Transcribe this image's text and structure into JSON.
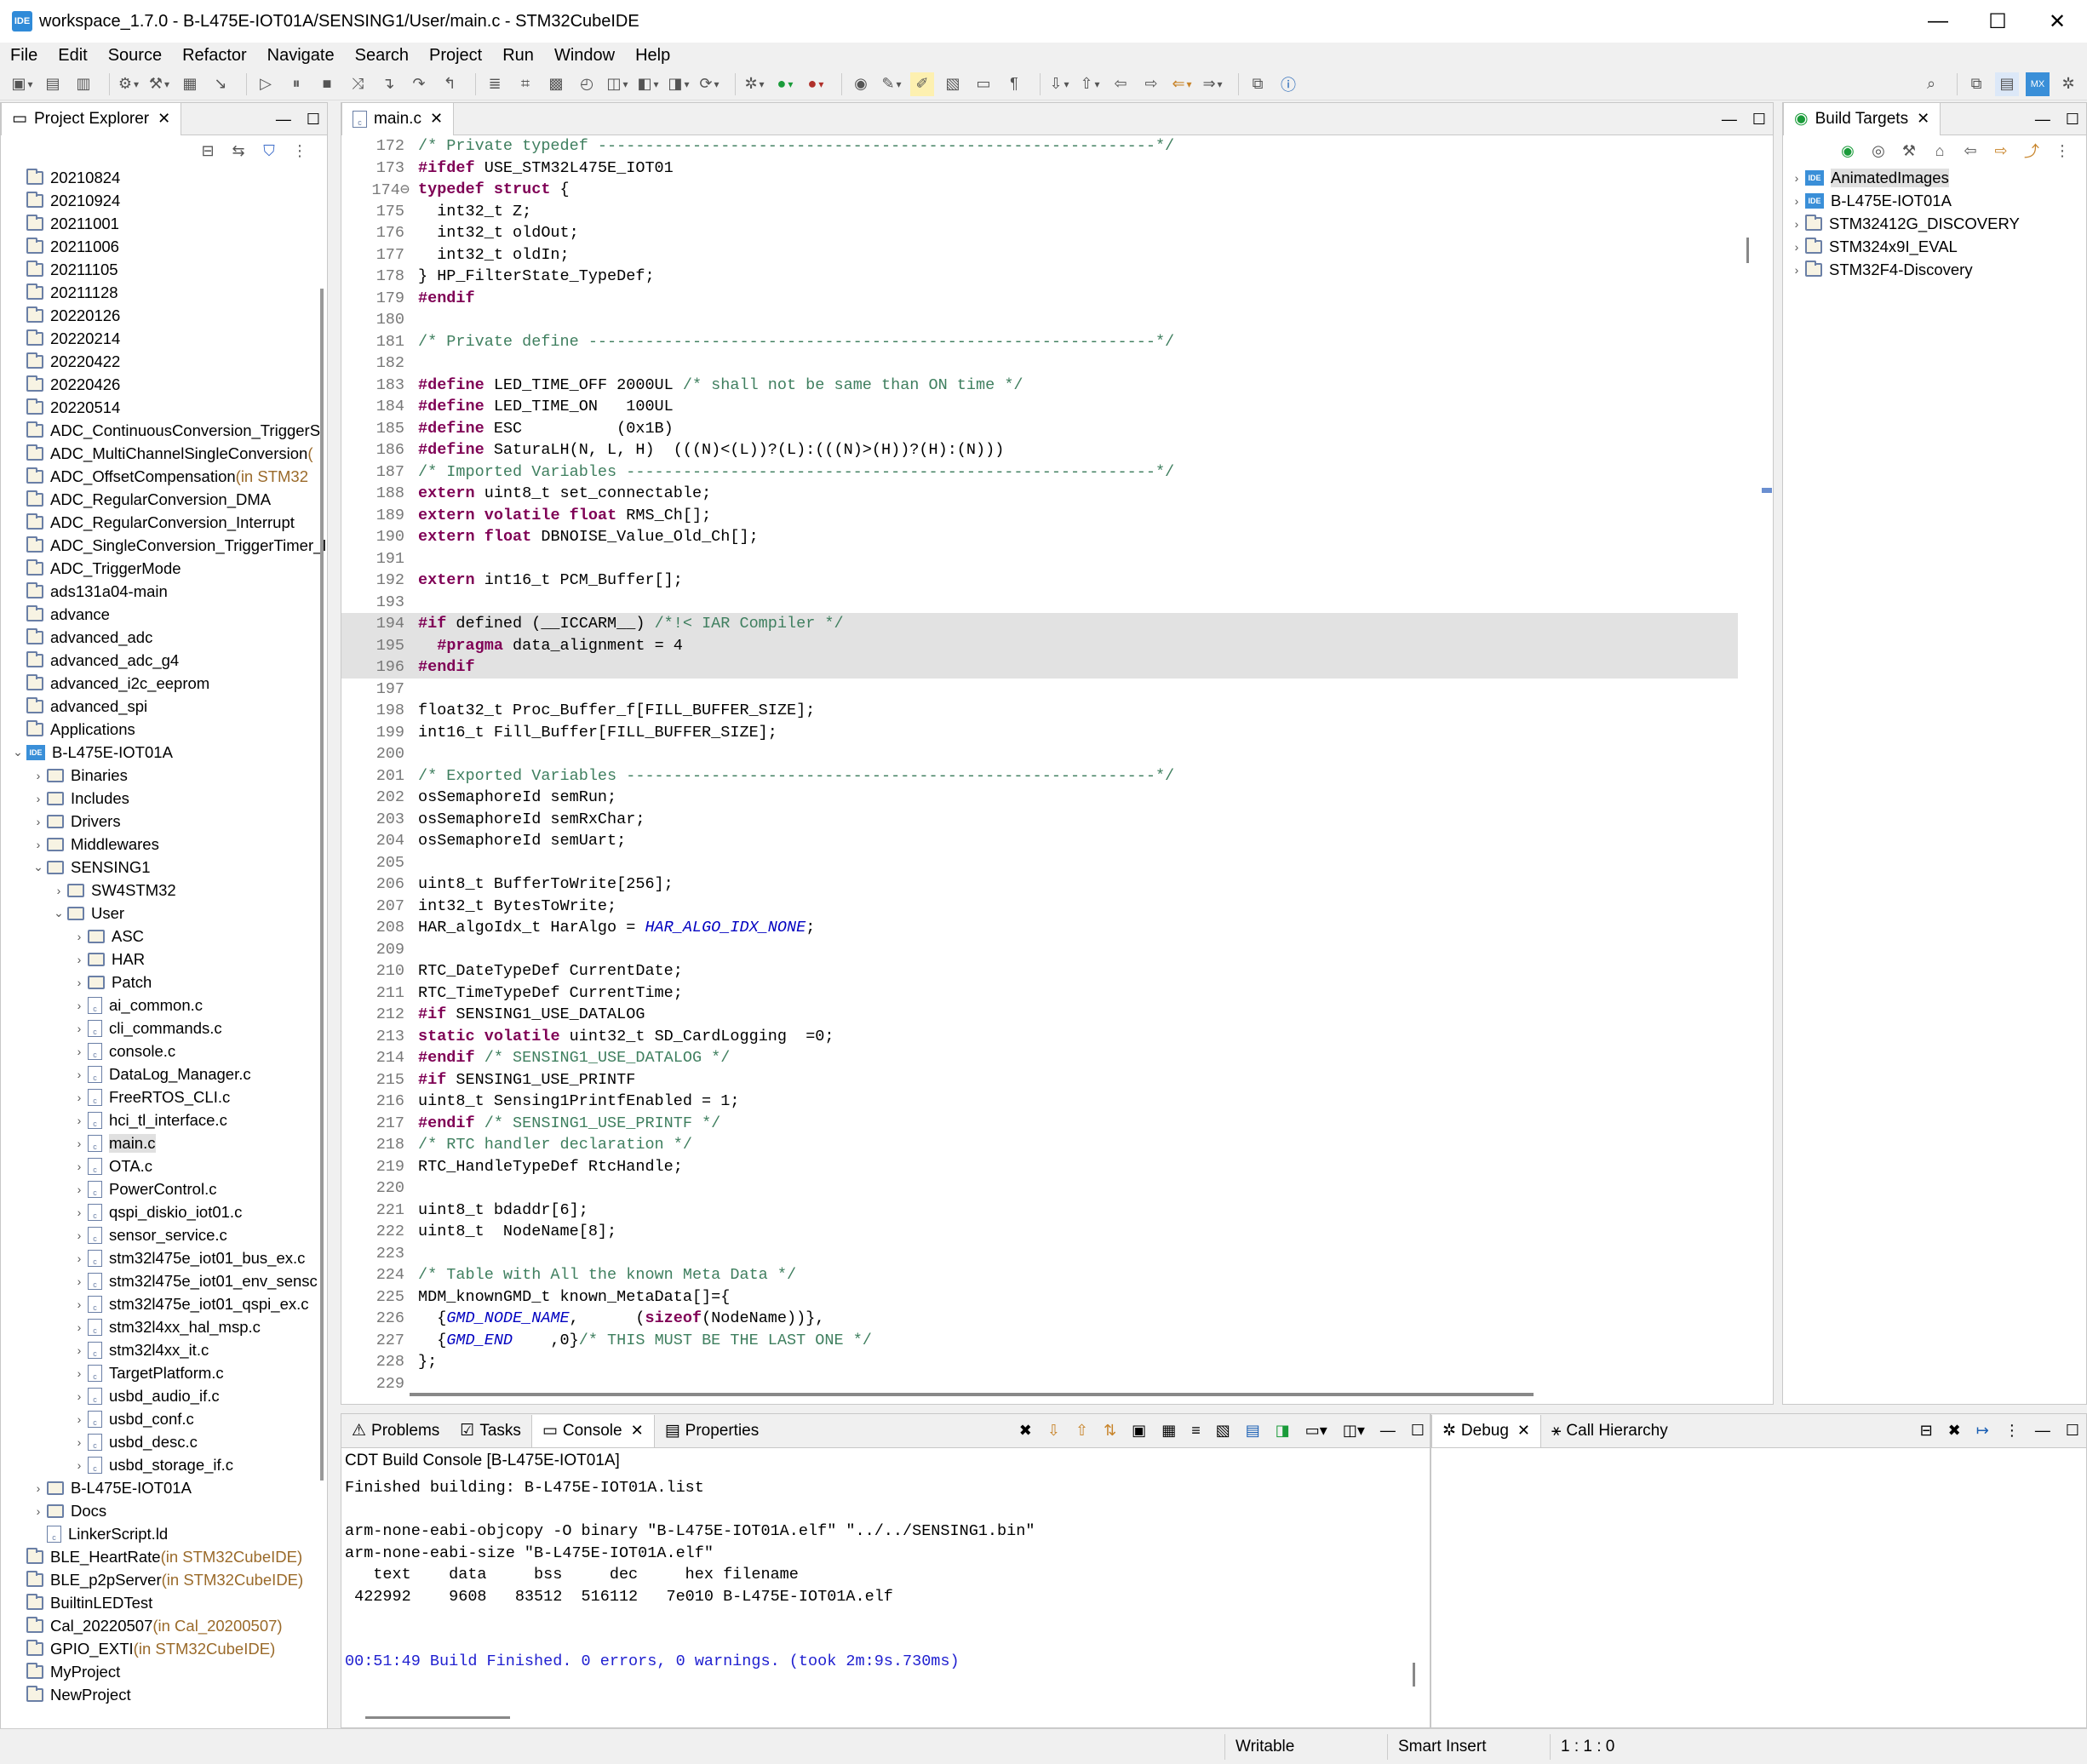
{
  "window": {
    "title": "workspace_1.7.0 - B-L475E-IOT01A/SENSING1/User/main.c - STM32CubeIDE",
    "app_icon": "IDE"
  },
  "menu": [
    "File",
    "Edit",
    "Source",
    "Refactor",
    "Navigate",
    "Search",
    "Project",
    "Run",
    "Window",
    "Help"
  ],
  "project_explorer": {
    "tab": "Project Explorer",
    "items": [
      {
        "label": "20210824",
        "indent": 0,
        "type": "proj",
        "tw": ""
      },
      {
        "label": "20210924",
        "indent": 0,
        "type": "proj",
        "tw": ""
      },
      {
        "label": "20211001",
        "indent": 0,
        "type": "proj",
        "tw": ""
      },
      {
        "label": "20211006",
        "indent": 0,
        "type": "proj",
        "tw": ""
      },
      {
        "label": "20211105",
        "indent": 0,
        "type": "proj",
        "tw": ""
      },
      {
        "label": "20211128",
        "indent": 0,
        "type": "proj",
        "tw": ""
      },
      {
        "label": "20220126",
        "indent": 0,
        "type": "proj",
        "tw": ""
      },
      {
        "label": "20220214",
        "indent": 0,
        "type": "proj",
        "tw": ""
      },
      {
        "label": "20220422",
        "indent": 0,
        "type": "proj",
        "tw": ""
      },
      {
        "label": "20220426",
        "indent": 0,
        "type": "proj",
        "tw": ""
      },
      {
        "label": "20220514",
        "indent": 0,
        "type": "proj",
        "tw": ""
      },
      {
        "label": "ADC_ContinuousConversion_TriggerS",
        "indent": 0,
        "type": "proj",
        "tw": ""
      },
      {
        "label": "ADC_MultiChannelSingleConversion",
        "indent": 0,
        "type": "proj",
        "tw": "",
        "suffix": " ("
      },
      {
        "label": "ADC_OffsetCompensation",
        "indent": 0,
        "type": "proj",
        "tw": "",
        "suffix": " (in STM32"
      },
      {
        "label": "ADC_RegularConversion_DMA",
        "indent": 0,
        "type": "proj",
        "tw": ""
      },
      {
        "label": "ADC_RegularConversion_Interrupt",
        "indent": 0,
        "type": "proj",
        "tw": ""
      },
      {
        "label": "ADC_SingleConversion_TriggerTimer_I",
        "indent": 0,
        "type": "proj",
        "tw": ""
      },
      {
        "label": "ADC_TriggerMode",
        "indent": 0,
        "type": "proj",
        "tw": ""
      },
      {
        "label": "ads131a04-main",
        "indent": 0,
        "type": "proj",
        "tw": ""
      },
      {
        "label": "advance",
        "indent": 0,
        "type": "proj",
        "tw": ""
      },
      {
        "label": "advanced_adc",
        "indent": 0,
        "type": "proj",
        "tw": ""
      },
      {
        "label": "advanced_adc_g4",
        "indent": 0,
        "type": "proj",
        "tw": ""
      },
      {
        "label": "advanced_i2c_eeprom",
        "indent": 0,
        "type": "proj",
        "tw": ""
      },
      {
        "label": "advanced_spi",
        "indent": 0,
        "type": "proj",
        "tw": ""
      },
      {
        "label": "Applications",
        "indent": 0,
        "type": "proj",
        "tw": ""
      },
      {
        "label": "B-L475E-IOT01A",
        "indent": 0,
        "type": "ide",
        "tw": "⌄"
      },
      {
        "label": "Binaries",
        "indent": 1,
        "type": "folder",
        "tw": "›"
      },
      {
        "label": "Includes",
        "indent": 1,
        "type": "folder",
        "tw": "›"
      },
      {
        "label": "Drivers",
        "indent": 1,
        "type": "folder",
        "tw": "›"
      },
      {
        "label": "Middlewares",
        "indent": 1,
        "type": "folder",
        "tw": "›"
      },
      {
        "label": "SENSING1",
        "indent": 1,
        "type": "folder",
        "tw": "⌄"
      },
      {
        "label": "SW4STM32",
        "indent": 2,
        "type": "folder",
        "tw": "›"
      },
      {
        "label": "User",
        "indent": 2,
        "type": "folder",
        "tw": "⌄"
      },
      {
        "label": "ASC",
        "indent": 3,
        "type": "folder",
        "tw": "›"
      },
      {
        "label": "HAR",
        "indent": 3,
        "type": "folder",
        "tw": "›"
      },
      {
        "label": "Patch",
        "indent": 3,
        "type": "folder",
        "tw": "›"
      },
      {
        "label": "ai_common.c",
        "indent": 3,
        "type": "file",
        "tw": "›"
      },
      {
        "label": "cli_commands.c",
        "indent": 3,
        "type": "file",
        "tw": "›"
      },
      {
        "label": "console.c",
        "indent": 3,
        "type": "file",
        "tw": "›"
      },
      {
        "label": "DataLog_Manager.c",
        "indent": 3,
        "type": "file",
        "tw": "›"
      },
      {
        "label": "FreeRTOS_CLI.c",
        "indent": 3,
        "type": "file",
        "tw": "›"
      },
      {
        "label": "hci_tl_interface.c",
        "indent": 3,
        "type": "file",
        "tw": "›"
      },
      {
        "label": "main.c",
        "indent": 3,
        "type": "file",
        "tw": "›",
        "selected": true
      },
      {
        "label": "OTA.c",
        "indent": 3,
        "type": "file",
        "tw": "›"
      },
      {
        "label": "PowerControl.c",
        "indent": 3,
        "type": "file",
        "tw": "›"
      },
      {
        "label": "qspi_diskio_iot01.c",
        "indent": 3,
        "type": "file",
        "tw": "›"
      },
      {
        "label": "sensor_service.c",
        "indent": 3,
        "type": "file",
        "tw": "›"
      },
      {
        "label": "stm32l475e_iot01_bus_ex.c",
        "indent": 3,
        "type": "file",
        "tw": "›"
      },
      {
        "label": "stm32l475e_iot01_env_sensc",
        "indent": 3,
        "type": "file",
        "tw": "›"
      },
      {
        "label": "stm32l475e_iot01_qspi_ex.c",
        "indent": 3,
        "type": "file",
        "tw": "›"
      },
      {
        "label": "stm32l4xx_hal_msp.c",
        "indent": 3,
        "type": "file",
        "tw": "›"
      },
      {
        "label": "stm32l4xx_it.c",
        "indent": 3,
        "type": "file",
        "tw": "›"
      },
      {
        "label": "TargetPlatform.c",
        "indent": 3,
        "type": "file",
        "tw": "›"
      },
      {
        "label": "usbd_audio_if.c",
        "indent": 3,
        "type": "file",
        "tw": "›"
      },
      {
        "label": "usbd_conf.c",
        "indent": 3,
        "type": "file",
        "tw": "›"
      },
      {
        "label": "usbd_desc.c",
        "indent": 3,
        "type": "file",
        "tw": "›"
      },
      {
        "label": "usbd_storage_if.c",
        "indent": 3,
        "type": "file",
        "tw": "›"
      },
      {
        "label": "B-L475E-IOT01A",
        "indent": 1,
        "type": "folder",
        "tw": "›"
      },
      {
        "label": "Docs",
        "indent": 1,
        "type": "folder",
        "tw": "›"
      },
      {
        "label": "LinkerScript.ld",
        "indent": 1,
        "type": "file",
        "tw": ""
      },
      {
        "label": "BLE_HeartRate",
        "indent": 0,
        "type": "proj",
        "tw": "",
        "suffix": " (in STM32CubeIDE)"
      },
      {
        "label": "BLE_p2pServer",
        "indent": 0,
        "type": "proj",
        "tw": "",
        "suffix": " (in STM32CubeIDE)"
      },
      {
        "label": "BuiltinLEDTest",
        "indent": 0,
        "type": "proj",
        "tw": ""
      },
      {
        "label": "Cal_20220507",
        "indent": 0,
        "type": "proj",
        "tw": "",
        "suffix": " (in Cal_20200507)"
      },
      {
        "label": "GPIO_EXTI",
        "indent": 0,
        "type": "proj",
        "tw": "",
        "suffix": " (in STM32CubeIDE)"
      },
      {
        "label": "MyProject",
        "indent": 0,
        "type": "proj",
        "tw": ""
      },
      {
        "label": "NewProject",
        "indent": 0,
        "type": "proj",
        "tw": ""
      }
    ]
  },
  "editor": {
    "tab": "main.c",
    "lines": [
      {
        "n": "172",
        "t": "/* Private typedef -----------------------------------------------------------*/",
        "c": "cm"
      },
      {
        "n": "173",
        "t": "#ifdef USE_STM32L475E_IOT01",
        "c": "pp"
      },
      {
        "n": "174",
        "t": "typedef struct {",
        "c": "k",
        "fold": true
      },
      {
        "n": "175",
        "t": "  int32_t Z;"
      },
      {
        "n": "176",
        "t": "  int32_t oldOut;"
      },
      {
        "n": "177",
        "t": "  int32_t oldIn;"
      },
      {
        "n": "178",
        "t": "} HP_FilterState_TypeDef;"
      },
      {
        "n": "179",
        "t": "#endif",
        "c": "pp"
      },
      {
        "n": "180",
        "t": ""
      },
      {
        "n": "181",
        "t": "/* Private define ------------------------------------------------------------*/",
        "c": "cm"
      },
      {
        "n": "182",
        "t": ""
      },
      {
        "n": "183",
        "t": "#define LED_TIME_OFF 2000UL /* shall not be same than ON time */",
        "c": "pp"
      },
      {
        "n": "184",
        "t": "#define LED_TIME_ON   100UL",
        "c": "pp"
      },
      {
        "n": "185",
        "t": "#define ESC          (0x1B)",
        "c": "pp"
      },
      {
        "n": "186",
        "t": "#define SaturaLH(N, L, H)  (((N)<(L))?(L):(((N)>(H))?(H):(N)))",
        "c": "pp"
      },
      {
        "n": "187",
        "t": "/* Imported Variables --------------------------------------------------------*/",
        "c": "cm"
      },
      {
        "n": "188",
        "t": "extern uint8_t set_connectable;",
        "c": "k"
      },
      {
        "n": "189",
        "t": "extern volatile float RMS_Ch[];",
        "c": "k"
      },
      {
        "n": "190",
        "t": "extern float DBNOISE_Value_Old_Ch[];",
        "c": "k"
      },
      {
        "n": "191",
        "t": ""
      },
      {
        "n": "192",
        "t": "extern int16_t PCM_Buffer[];",
        "c": "k"
      },
      {
        "n": "193",
        "t": ""
      },
      {
        "n": "194",
        "t": "#if defined (__ICCARM__) /*!< IAR Compiler */",
        "c": "pp",
        "hl": true
      },
      {
        "n": "195",
        "t": "  #pragma data_alignment = 4",
        "c": "pp",
        "hl": true
      },
      {
        "n": "196",
        "t": "#endif",
        "c": "pp",
        "hl": true
      },
      {
        "n": "197",
        "t": ""
      },
      {
        "n": "198",
        "t": "float32_t Proc_Buffer_f[FILL_BUFFER_SIZE];"
      },
      {
        "n": "199",
        "t": "int16_t Fill_Buffer[FILL_BUFFER_SIZE];"
      },
      {
        "n": "200",
        "t": ""
      },
      {
        "n": "201",
        "t": "/* Exported Variables --------------------------------------------------------*/",
        "c": "cm"
      },
      {
        "n": "202",
        "t": "osSemaphoreId semRun;"
      },
      {
        "n": "203",
        "t": "osSemaphoreId semRxChar;"
      },
      {
        "n": "204",
        "t": "osSemaphoreId semUart;"
      },
      {
        "n": "205",
        "t": ""
      },
      {
        "n": "206",
        "t": "uint8_t BufferToWrite[256];"
      },
      {
        "n": "207",
        "t": "int32_t BytesToWrite;"
      },
      {
        "n": "208",
        "t": "HAR_algoIdx_t HarAlgo = HAR_ALGO_IDX_NONE;"
      },
      {
        "n": "209",
        "t": ""
      },
      {
        "n": "210",
        "t": "RTC_DateTypeDef CurrentDate;"
      },
      {
        "n": "211",
        "t": "RTC_TimeTypeDef CurrentTime;"
      },
      {
        "n": "212",
        "t": "#if SENSING1_USE_DATALOG",
        "c": "pp"
      },
      {
        "n": "213",
        "t": "static volatile uint32_t SD_CardLogging  =0;",
        "c": "k"
      },
      {
        "n": "214",
        "t": "#endif /* SENSING1_USE_DATALOG */",
        "c": "pp"
      },
      {
        "n": "215",
        "t": "#if SENSING1_USE_PRINTF",
        "c": "pp"
      },
      {
        "n": "216",
        "t": "uint8_t Sensing1PrintfEnabled = 1;"
      },
      {
        "n": "217",
        "t": "#endif /* SENSING1_USE_PRINTF */",
        "c": "pp"
      },
      {
        "n": "218",
        "t": "/* RTC handler declaration */",
        "c": "cm"
      },
      {
        "n": "219",
        "t": "RTC_HandleTypeDef RtcHandle;"
      },
      {
        "n": "220",
        "t": ""
      },
      {
        "n": "221",
        "t": "uint8_t bdaddr[6];"
      },
      {
        "n": "222",
        "t": "uint8_t  NodeName[8];"
      },
      {
        "n": "223",
        "t": ""
      },
      {
        "n": "224",
        "t": "/* Table with All the known Meta Data */",
        "c": "cm"
      },
      {
        "n": "225",
        "t": "MDM_knownGMD_t known_MetaData[]={"
      },
      {
        "n": "226",
        "t": "  {GMD_NODE_NAME,      (sizeof(NodeName))},"
      },
      {
        "n": "227",
        "t": "  {GMD_END    ,0}/* THIS MUST BE THE LAST ONE */"
      },
      {
        "n": "228",
        "t": "};"
      },
      {
        "n": "229",
        "t": ""
      }
    ]
  },
  "build_targets": {
    "tab": "Build Targets",
    "items": [
      "AnimatedImages",
      "B-L475E-IOT01A",
      "STM32412G_DISCOVERY",
      "STM324x9I_EVAL",
      "STM32F4-Discovery"
    ]
  },
  "console": {
    "tabs": [
      "Problems",
      "Tasks",
      "Console",
      "Properties"
    ],
    "title": "CDT Build Console [B-L475E-IOT01A]",
    "lines": [
      "Finished building: B-L475E-IOT01A.list",
      "",
      "arm-none-eabi-objcopy -O binary \"B-L475E-IOT01A.elf\" \"../../SENSING1.bin\"",
      "arm-none-eabi-size \"B-L475E-IOT01A.elf\"",
      "   text    data     bss     dec     hex filename",
      " 422992    9608   83512  516112   7e010 B-L475E-IOT01A.elf",
      "",
      "",
      "00:51:49 Build Finished. 0 errors, 0 warnings. (took 2m:9s.730ms)"
    ]
  },
  "debug": {
    "tabs": [
      "Debug",
      "Call Hierarchy"
    ]
  },
  "status": {
    "writable": "Writable",
    "insert": "Smart Insert",
    "position": "1 : 1 : 0"
  }
}
